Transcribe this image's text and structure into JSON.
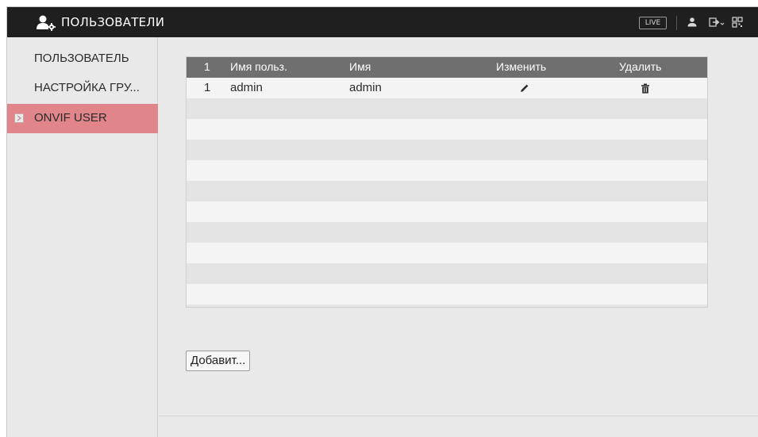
{
  "header": {
    "title": "ПОЛЬЗОВАТЕЛИ",
    "title_icon": "users-settings-icon",
    "live_label": "LIVE",
    "icons": [
      "user-icon",
      "logout-icon",
      "qr-code-icon"
    ]
  },
  "sidebar": {
    "items": [
      {
        "label": "ПОЛЬЗОВАТЕЛЬ",
        "active": false
      },
      {
        "label": "НАСТРОЙКА ГРУ...",
        "active": false
      },
      {
        "label": "ONVIF USER",
        "active": true
      }
    ]
  },
  "table": {
    "columns": [
      "1",
      "Имя польз.",
      "Имя",
      "Изменить",
      "Удалить"
    ],
    "rows": [
      {
        "index": "1",
        "username": "admin",
        "name": "admin",
        "edit_icon": "pencil-icon",
        "delete_icon": "trash-icon"
      }
    ]
  },
  "actions": {
    "add_label": "Добавит..."
  },
  "colors": {
    "topbar": "#1f1f1f",
    "active_item": "#e0868a",
    "table_header": "#6f6f6f"
  }
}
